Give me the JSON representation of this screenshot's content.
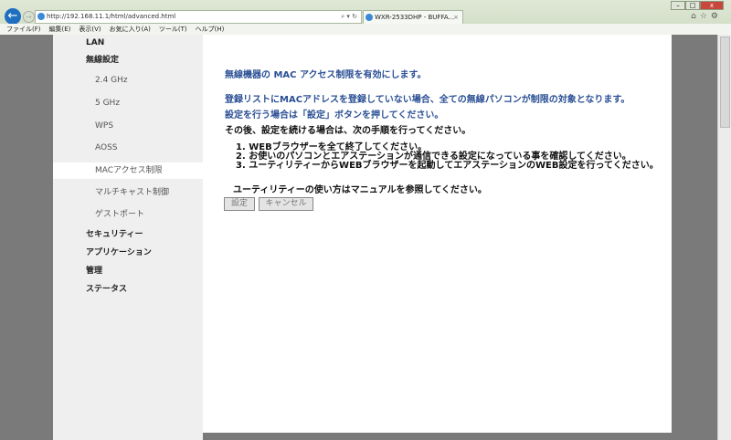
{
  "browser": {
    "url": "http://192.168.11.1/html/advanced.html",
    "tab_title": "WXR-2533DHP - BUFFA...",
    "menu": [
      "ファイル(F)",
      "編集(E)",
      "表示(V)",
      "お気に入り(A)",
      "ツール(T)",
      "ヘルプ(H)"
    ]
  },
  "sidebar": {
    "items": [
      {
        "label": "LAN",
        "level": 1
      },
      {
        "label": "無線設定",
        "level": 1
      },
      {
        "label": "2.4 GHz",
        "level": 2
      },
      {
        "label": "5 GHz",
        "level": 2
      },
      {
        "label": "WPS",
        "level": 2
      },
      {
        "label": "AOSS",
        "level": 2
      },
      {
        "label": "MACアクセス制限",
        "level": 2,
        "selected": true
      },
      {
        "label": "マルチキャスト制御",
        "level": 2
      },
      {
        "label": "ゲストポート",
        "level": 2
      },
      {
        "label": "セキュリティー",
        "level": 1
      },
      {
        "label": "アプリケーション",
        "level": 1
      },
      {
        "label": "管理",
        "level": 1
      },
      {
        "label": "ステータス",
        "level": 1
      }
    ]
  },
  "main": {
    "heading": "無線機器の MAC アクセス制限を有効にします。",
    "note1": "登録リストにMACアドレスを登録していない場合、全ての無線パソコンが制限の対象となります。",
    "note2": "設定を行う場合は「設定」ボタンを押してください。",
    "note3": "その後、設定を続ける場合は、次の手順を行ってください。",
    "steps": [
      "1. WEBブラウザーを全て終了してください。",
      "2. お使いのパソコンとエアステーションが通信できる設定になっている事を確認してください。",
      "3. ユーティリティーからWEBブラウザーを起動してエアステーションのWEB設定を行ってください。"
    ],
    "manual_note": "ユーティリティーの使い方はマニュアルを参照してください。",
    "apply_label": "設定",
    "cancel_label": "キャンセル"
  }
}
